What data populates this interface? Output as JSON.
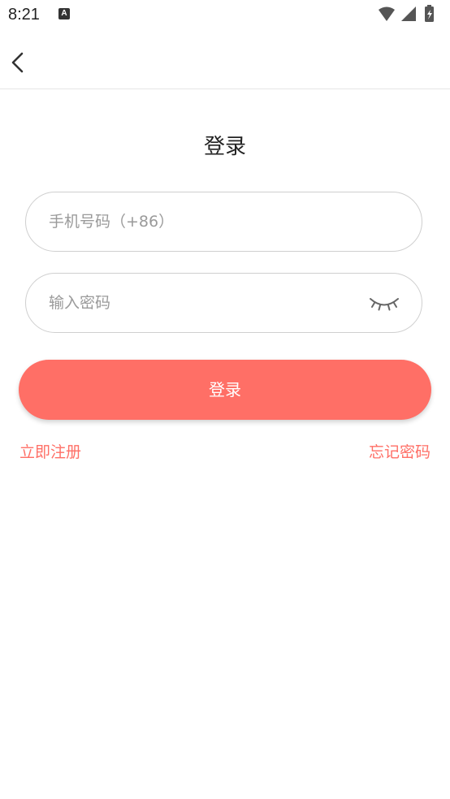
{
  "status_bar": {
    "time": "8:21",
    "app_icon_letter": "A"
  },
  "nav": {
    "back_icon": "chevron-left-icon"
  },
  "page": {
    "title": "登录"
  },
  "form": {
    "phone_placeholder": "手机号码（+86）",
    "phone_value": "",
    "password_placeholder": "输入密码",
    "password_value": "",
    "password_visibility_icon": "eye-closed-icon",
    "login_label": "登录"
  },
  "links": {
    "register": "立即注册",
    "forgot_password": "忘记密码"
  },
  "colors": {
    "accent": "#ff6f66",
    "input_border": "#cfcfcf",
    "divider": "#e6e6e6"
  }
}
